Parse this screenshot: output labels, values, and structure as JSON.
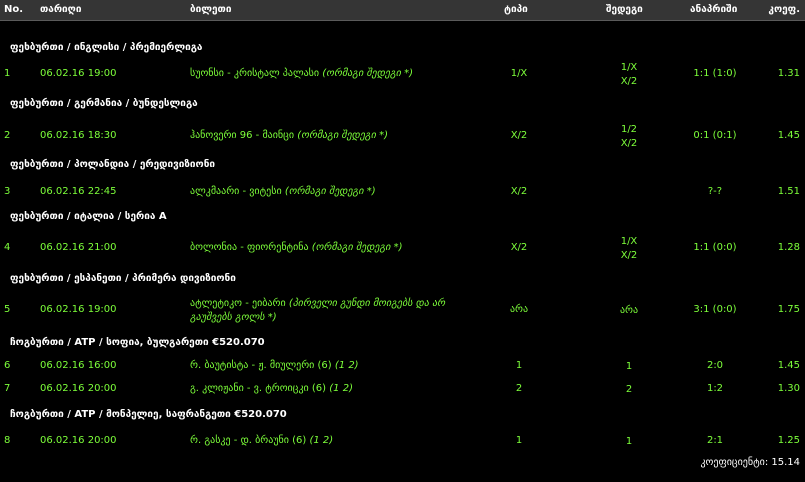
{
  "header": {
    "no": "No.",
    "date": "თარიღი",
    "event": "ბილეთი",
    "type": "ტიპი",
    "result": "შედეგი",
    "outcome": "ანაპრიში",
    "odds": "კოეფ."
  },
  "sections": [
    {
      "title": "ფეხბურთი / ინგლისი / პრემიერლიგა",
      "rows": [
        {
          "no": "1",
          "date": "06.02.16 19:00",
          "event": "სუონსი - კრისტალ პალასი",
          "note": "(ორმაგი შედეგი *)",
          "type": "1/X",
          "result": [
            "1/X",
            "X/2"
          ],
          "outcome": "1:1 (1:0)",
          "odds": "1.31"
        }
      ]
    },
    {
      "title": "ფეხბურთი / გერმანია / ბუნდესლიგა",
      "rows": [
        {
          "no": "2",
          "date": "06.02.16 18:30",
          "event": "ჰანოვერი 96 - მაინცი",
          "note": "(ორმაგი შედეგი *)",
          "type": "X/2",
          "result": [
            "1/2",
            "X/2"
          ],
          "outcome": "0:1 (0:1)",
          "odds": "1.45"
        }
      ]
    },
    {
      "title": "ფეხბურთი / პოლანდია / ერედივიზიონი",
      "rows": [
        {
          "no": "3",
          "date": "06.02.16 22:45",
          "event": "ალკმაარი - ვიტესი",
          "note": "(ორმაგი შედეგი *)",
          "type": "X/2",
          "result": [],
          "outcome": "?-?",
          "odds": "1.51"
        }
      ]
    },
    {
      "title": "ფეხბურთი / იტალია / სერია A",
      "rows": [
        {
          "no": "4",
          "date": "06.02.16 21:00",
          "event": "ბოლონია - ფიორენტინა",
          "note": "(ორმაგი შედეგი *)",
          "type": "X/2",
          "result": [
            "1/X",
            "X/2"
          ],
          "outcome": "1:1 (0:0)",
          "odds": "1.28"
        }
      ]
    },
    {
      "title": "ფეხბურთი / ესპანეთი / პრიმერა დივიზიონი",
      "rows": [
        {
          "no": "5",
          "date": "06.02.16 19:00",
          "event": "ატლეტიკო - ეიბარი",
          "note": "(პირველი გუნდი მოიგებს და არ",
          "note2": "გაუშვებს გოლს *)",
          "type": "არა",
          "result": [
            "არა"
          ],
          "outcome": "3:1 (0:0)",
          "odds": "1.75"
        }
      ]
    },
    {
      "title": "ჩოგბურთი / ATP / სოფია, ბულგარეთი €520.070",
      "rows": [
        {
          "no": "6",
          "date": "06.02.16 16:00",
          "event": "რ. ბაუტისტა - ჟ. მიულერი (6)",
          "note": "(1 2)",
          "type": "1",
          "result": [
            "1"
          ],
          "outcome": "2:0",
          "odds": "1.45"
        },
        {
          "no": "7",
          "date": "06.02.16 20:00",
          "event": "გ. კლიჟანი - ვ. ტროიცკი (6)",
          "note": "(1 2)",
          "type": "2",
          "result": [
            "2"
          ],
          "outcome": "1:2",
          "odds": "1.30"
        }
      ]
    },
    {
      "title": "ჩოგბურთი / ATP / მონპელიე, საფრანგეთი €520.070",
      "rows": [
        {
          "no": "8",
          "date": "06.02.16 20:00",
          "event": "რ. გასკე - დ. ბრაუნი (6)",
          "note": "(1 2)",
          "type": "1",
          "result": [
            "1"
          ],
          "outcome": "2:1",
          "odds": "1.25"
        }
      ]
    }
  ],
  "total": "კოეფიციენტი: 15.14",
  "colors": {
    "accent": "#7dff3a",
    "header_bg": "#353535",
    "background": "#000000"
  }
}
